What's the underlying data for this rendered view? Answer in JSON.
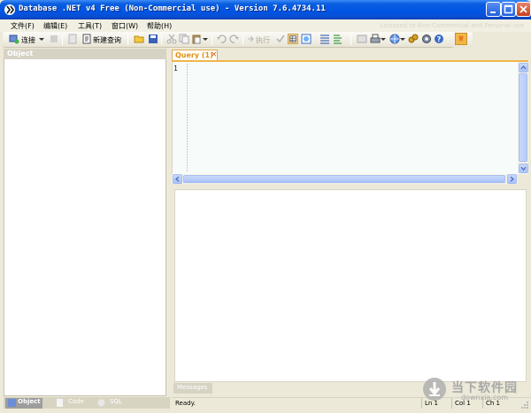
{
  "window": {
    "title": "Database .NET v4 Free (Non-Commercial use) - Version 7.6.4734.11",
    "licensed_text": "Licensed to Non-Commercial and Personal use"
  },
  "menu": {
    "items": [
      "文件(F)",
      "编辑(E)",
      "工具(T)",
      "窗口(W)",
      "帮助(H)"
    ]
  },
  "toolbar": {
    "connect_label": "连接",
    "new_query_label": "新建查询",
    "execute_label": "执行"
  },
  "object_panel": {
    "header": "Object",
    "tabs": [
      "Object",
      "Code",
      "SQL"
    ]
  },
  "query_tab": {
    "label": "Query (1)",
    "close_glyph": "×"
  },
  "editor": {
    "line_number": "1"
  },
  "messages_tab": {
    "label": "Messages"
  },
  "status": {
    "state": "Ready.",
    "line": "Ln 1",
    "col": "Col 1",
    "ch": "Ch 1"
  },
  "watermark": {
    "logo_text": "当下软件园",
    "site": "downxia.com"
  },
  "colors": {
    "title_bar": "#0054e3",
    "tab_accent": "#f0b54a",
    "editor_bg": "#f7fbf9"
  }
}
